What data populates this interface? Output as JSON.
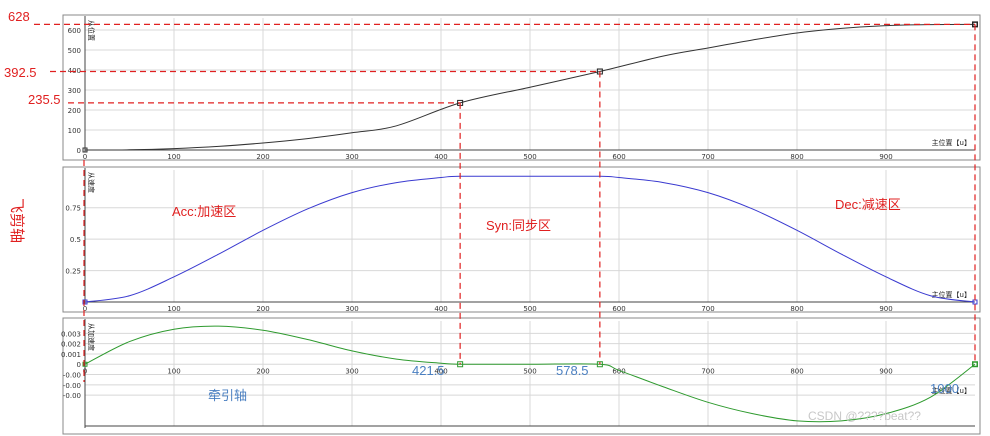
{
  "colors": {
    "panel_bg": "#ffffff",
    "grid": "#d8d8d8",
    "frame": "#888888",
    "position_curve": "#333333",
    "velocity_curve": "#3a3ad0",
    "accel_curve": "#2e9a2e",
    "guide_red": "#e02020",
    "annotation_blue": "#4a7fc1"
  },
  "annotations": {
    "left_628": "628",
    "left_392": "392.5",
    "left_235": "235.5",
    "side_label": "飞剪轴",
    "acc_zone": "Acc:加速区",
    "syn_zone": "Syn:同步区",
    "dec_zone": "Dec:减速区",
    "mark_421": "421.5",
    "mark_578": "578.5",
    "mark_1000": "1000",
    "traction_axis": "牵引轴",
    "watermark": "CSDN @????beat??"
  },
  "chart_data": [
    {
      "type": "line",
      "name_label": "从位置",
      "xlabel": "主位置【u】",
      "xlim": [
        0,
        1000
      ],
      "ylim": [
        0,
        660
      ],
      "x_ticks": [
        0,
        100,
        200,
        300,
        400,
        500,
        600,
        700,
        800,
        900
      ],
      "y_ticks": [
        0,
        100,
        200,
        300,
        400,
        500,
        600
      ],
      "series": [
        {
          "x": [
            0,
            50,
            100,
            150,
            200,
            250,
            300,
            350,
            421.5,
            500,
            578.5,
            650,
            700,
            750,
            800,
            850,
            900,
            950,
            1000
          ],
          "values": [
            0,
            1,
            7,
            18,
            35,
            57,
            86,
            121,
            235.5,
            314,
            392.5,
            470,
            510,
            550,
            585,
            608,
            622,
            627,
            628
          ]
        }
      ],
      "markers": [
        {
          "x": 421.5,
          "y": 235.5
        },
        {
          "x": 578.5,
          "y": 392.5
        },
        {
          "x": 1000,
          "y": 628
        }
      ]
    },
    {
      "type": "line",
      "name_label": "从速度",
      "xlabel": "主位置【u】",
      "xlim": [
        0,
        1000
      ],
      "ylim": [
        0,
        1.05
      ],
      "x_ticks": [
        0,
        100,
        200,
        300,
        400,
        500,
        600,
        700,
        800,
        900
      ],
      "y_ticks": [
        0.25,
        0.5,
        0.75
      ],
      "series": [
        {
          "x": [
            0,
            50,
            100,
            150,
            200,
            250,
            300,
            350,
            400,
            421.5,
            500,
            578.5,
            600,
            650,
            700,
            750,
            800,
            850,
            900,
            950,
            1000
          ],
          "values": [
            0,
            0.05,
            0.2,
            0.38,
            0.57,
            0.74,
            0.87,
            0.95,
            0.99,
            1.0,
            1.0,
            1.0,
            0.99,
            0.95,
            0.87,
            0.74,
            0.57,
            0.38,
            0.2,
            0.05,
            0
          ]
        }
      ]
    },
    {
      "type": "line",
      "name_label": "从加速度",
      "xlabel": "主位置【u】",
      "xlim": [
        0,
        1000
      ],
      "ylim": [
        -0.006,
        0.0042
      ],
      "x_ticks": [
        0,
        100,
        200,
        300,
        400,
        500,
        600,
        700,
        800,
        900
      ],
      "y_ticks": [
        0.003,
        0.002,
        0.001,
        0,
        -0.001,
        -0.002,
        -0.003
      ],
      "y_tick_labels": [
        "0.003",
        "0.002",
        "0.001",
        "0",
        "-0.00",
        "-0.00",
        "-0.00"
      ],
      "series": [
        {
          "x": [
            0,
            50,
            100,
            150,
            200,
            250,
            300,
            350,
            400,
            421.5,
            500,
            578.5,
            600,
            650,
            700,
            750,
            800,
            850,
            900,
            950,
            1000
          ],
          "values": [
            0,
            0.0022,
            0.0034,
            0.0037,
            0.0033,
            0.0024,
            0.0013,
            0.0005,
            0.0001,
            0,
            0,
            0,
            -0.0006,
            -0.0022,
            -0.0037,
            -0.0048,
            -0.0055,
            -0.0055,
            -0.0048,
            -0.0032,
            0
          ]
        }
      ]
    }
  ]
}
